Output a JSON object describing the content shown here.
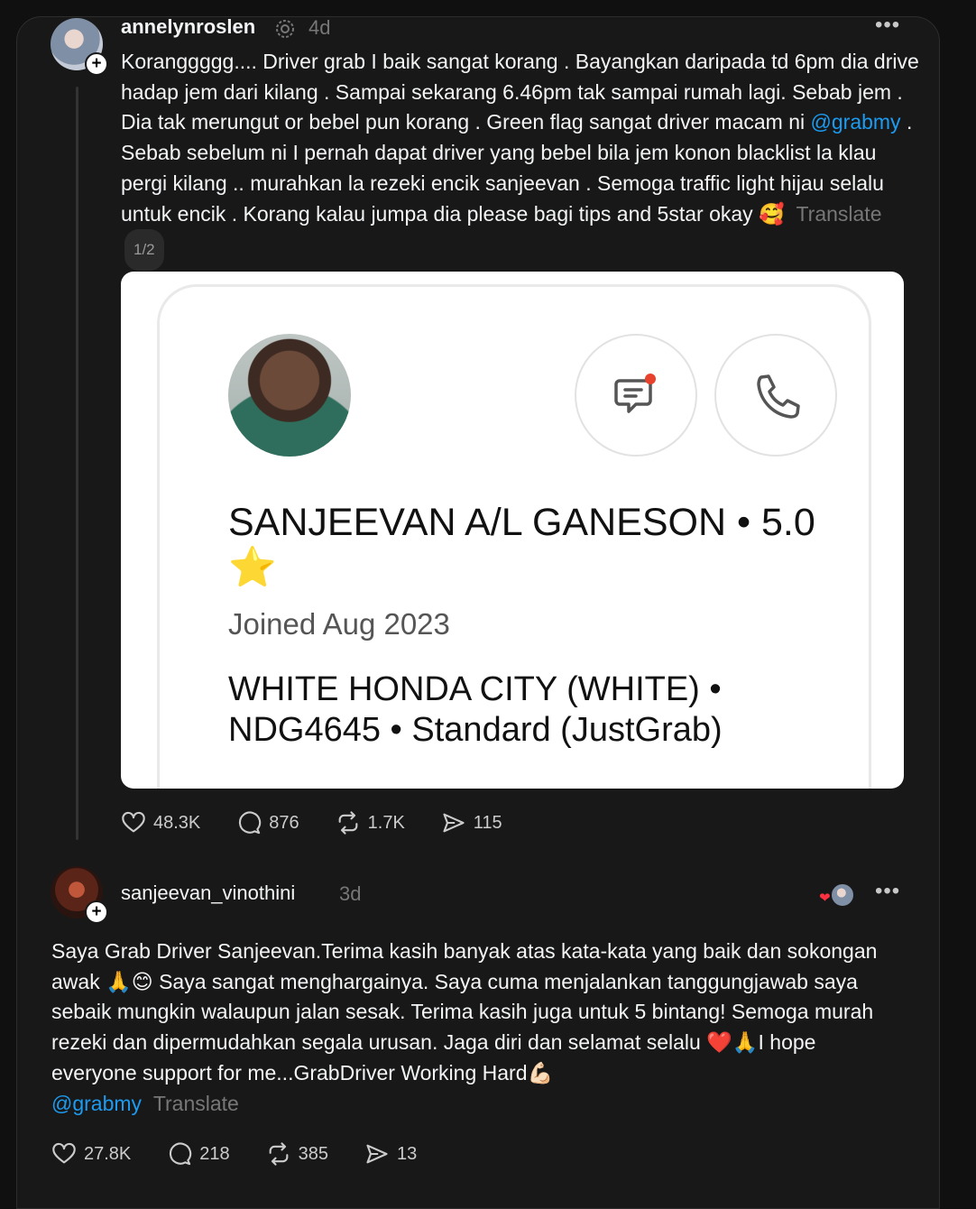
{
  "post": {
    "username": "annelynroslen",
    "time": "4d",
    "text_before_mention": "Koranggggg.... Driver grab I baik sangat korang . Bayangkan daripada td 6pm dia drive hadap jem dari kilang . Sampai sekarang 6.46pm tak sampai rumah lagi. Sebab jem . Dia tak merungut or bebel pun korang . Green flag sangat driver macam ni ",
    "mention": "@grabmy",
    "text_after_mention": " . Sebab sebelum ni I pernah dapat driver yang bebel bila jem konon blacklist la klau pergi kilang .. murahkan la rezeki encik sanjeevan . Semoga traffic light hijau selalu untuk encik . Korang kalau jumpa dia please bagi tips and 5star okay 🥰",
    "translate": "Translate",
    "pager": "1/2",
    "card": {
      "name": "SANJEEVAN A/L GANESON • 5.0 ⭐",
      "joined": "Joined Aug 2023",
      "car": "WHITE HONDA CITY (WHITE) • NDG4645 • Standard (JustGrab)"
    },
    "stats": {
      "likes": "48.3K",
      "comments": "876",
      "reposts": "1.7K",
      "shares": "115"
    }
  },
  "reply": {
    "username": "sanjeevan_vinothini",
    "time": "3d",
    "text": "Saya Grab Driver Sanjeevan.Terima kasih banyak atas kata-kata yang baik dan sokongan awak 🙏😊 Saya sangat menghargainya. Saya cuma menjalankan tanggungjawab saya sebaik mungkin walaupun jalan sesak. Terima kasih juga untuk 5 bintang! Semoga murah rezeki dan dipermudahkan segala urusan. Jaga diri dan selamat selalu ❤️🙏I hope everyone support for me...GrabDriver Working Hard💪🏻",
    "mention": "@grabmy",
    "translate": "Translate",
    "stats": {
      "likes": "27.8K",
      "comments": "218",
      "reposts": "385",
      "shares": "13"
    }
  },
  "colors": {
    "mention": "#1d9bf0",
    "background": "#181818",
    "muted": "#777777"
  }
}
